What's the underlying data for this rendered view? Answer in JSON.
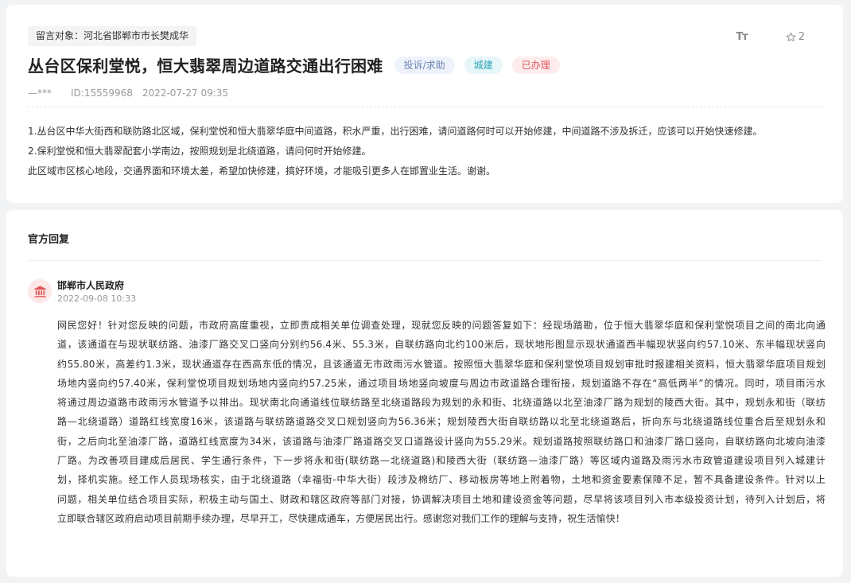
{
  "message": {
    "target_label": "留言对象：河北省邯郸市市长樊成华",
    "title": "丛台区保利堂悦，恒大翡翠周边道路交通出行困难",
    "badges": [
      "投诉/求助",
      "城建",
      "已办理"
    ],
    "author": "—***",
    "id_text": "ID:15559968",
    "datetime": "2022-07-27 09:35",
    "font_tool_label": "Tт",
    "star_count": "2",
    "body": [
      "1.丛台区中华大街西和联防路北区域，保利堂悦和恒大翡翠华庭中间道路，积水严重，出行困难，请问道路何时可以开始修建，中间道路不涉及拆迁，应该可以开始快速修建。",
      "2.保利堂悦和恒大翡翠配套小学南边，按照规划是北绕道路，请问何时开始修建。",
      "此区域市区核心地段，交通界面和环境太差，希望加快修建，搞好环境，才能吸引更多人在邯置业生活。谢谢。"
    ]
  },
  "reply": {
    "section_title": "官方回复",
    "org_name": "邯郸市人民政府",
    "org_date": "2022-09-08 10:33",
    "body_lines": [
      "网民您好！针对您反映的问题，市政府高度重视，立即责成相关单位调查处理，现就您反映的问题答复如下：经现场踏勘，位于恒大翡翠华庭和保利堂悦项目之间的南北向通",
      "道，该通道在与现状联纺路、油漆厂路交叉口竖向分别约56.4米、55.3米，自联纺路向北约100米后，现状地形图显示现状通道西半幅现状竖向约57.10米、东半幅现状竖向",
      "约55.80米，高差约1.3米，现状通道存在西高东低的情况，且该通道无市政雨污水管道。按照恒大翡翠华庭和保利堂悦项目规划审批时报建相关资料，恒大翡翠华庭项目规划",
      "场地内竖向约57.40米，保利堂悦项目规划场地内竖向约57.25米，通过项目场地竖向坡度与周边市政道路合理衔接，规划道路不存在“高低两半”的情况。同时，项目雨污水",
      "将通过周边道路市政雨污水管道予以排出。现状南北向通道线位联纺路至北绕道路段为规划的永和街、北绕道路以北至油漆厂路为规划的陵西大街。其中，规划永和街（联纺",
      "路—北绕道路）道路红线宽度16米，该道路与联纺路道路交叉口规划竖向为56.36米；规划陵西大街自联纺路以北至北绕道路后，折向东与北绕道路线位重合后至规划永和",
      "街，之后向北至油漆厂路，道路红线宽度为34米，该道路与油漆厂路道路交叉口道路设计竖向为55.29米。规划道路按照联纺路口和油漆厂路口竖向，自联纺路向北坡向油漆",
      "厂路。为改善项目建成后居民、学生通行条件，下一步将永和街(联纺路—北绕道路)和陵西大街（联纺路—油漆厂路）等区域内道路及雨污水市政管道建设项目列入城建计",
      "划，择机实施。经工作人员现场核实，由于北绕道路（幸福街-中华大街）段涉及棉纺厂、移动板房等地上附着物，土地和资金要素保障不足，暂不具备建设条件。针对以上",
      "问题，相关单位结合项目实际，积极主动与国土、财政和辖区政府等部门对接，协调解决项目土地和建设资金等问题，尽早将该项目列入市本级投资计划，待列入计划后，将",
      "立即联合辖区政府启动项目前期手续办理，尽早开工，尽快建成通车，方便居民出行。感谢您对我们工作的理解与支持，祝生活愉快！"
    ]
  },
  "colors": {
    "page_bg": "#f2f3f5",
    "badge_category": "#6b85b4",
    "badge_field": "#2fa6b9",
    "badge_status": "#e0555a",
    "logo_red": "#e05a5a"
  }
}
